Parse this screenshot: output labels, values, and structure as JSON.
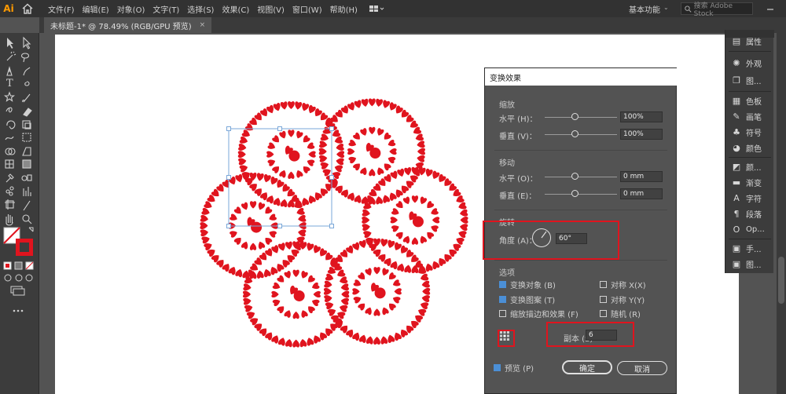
{
  "app": {
    "logo": "Ai"
  },
  "menu": [
    "文件(F)",
    "编辑(E)",
    "对象(O)",
    "文字(T)",
    "选择(S)",
    "效果(C)",
    "视图(V)",
    "窗口(W)",
    "帮助(H)"
  ],
  "workspace": {
    "label": "基本功能",
    "search_placeholder": "搜索 Adobe Stock"
  },
  "document_tab": {
    "title": "未标题-1* @ 78.49% (RGB/GPU 预览)",
    "close": "×"
  },
  "right_panel": [
    {
      "icon": "properties-icon",
      "label": "属性"
    },
    {
      "icon": "appearance-icon",
      "label": "外观"
    },
    {
      "icon": "graphic-styles-icon",
      "label": "图..."
    },
    {
      "icon": "swatches-icon",
      "label": "色板"
    },
    {
      "icon": "brushes-icon",
      "label": "画笔"
    },
    {
      "icon": "symbols-icon",
      "label": "符号"
    },
    {
      "icon": "color-icon",
      "label": "颜色"
    },
    {
      "icon": "color-guide-icon",
      "label": "颜..."
    },
    {
      "icon": "gradient-icon",
      "label": "渐变"
    },
    {
      "icon": "character-icon",
      "label": "字符"
    },
    {
      "icon": "paragraph-icon",
      "label": "段落"
    },
    {
      "icon": "opentype-icon",
      "label": "Op..."
    },
    {
      "icon": "hand-tool-panel-icon",
      "label": "手..."
    },
    {
      "icon": "image-panel-icon",
      "label": "图..."
    }
  ],
  "dialog": {
    "title": "变换效果",
    "scale": {
      "section": "缩放",
      "h_label": "水平 (H)：",
      "h_value": "100%",
      "v_label": "垂直 (V)：",
      "v_value": "100%"
    },
    "move": {
      "section": "移动",
      "h_label": "水平 (O)：",
      "h_value": "0 mm",
      "v_label": "垂直 (E)：",
      "v_value": "0 mm"
    },
    "rotate": {
      "section": "旋转",
      "angle_label": "角度 (A)：",
      "angle_value": "60°"
    },
    "options": {
      "section": "选项",
      "transform_objects": "变换对象 (B)",
      "transform_patterns": "变换图案 (T)",
      "scale_strokes": "缩放描边和效果 (F)",
      "reflect_x": "对称 X(X)",
      "reflect_y": "对称 Y(Y)",
      "random": "随机 (R)"
    },
    "copies": {
      "label": "副本 (S)",
      "value": "6"
    },
    "preview": "预览 (P)",
    "ok": "确定",
    "cancel": "取消"
  },
  "colors": {
    "artwork_red": "#e0141e",
    "highlight_red": "#e0141e",
    "checkbox_blue": "#4b8fd6"
  }
}
